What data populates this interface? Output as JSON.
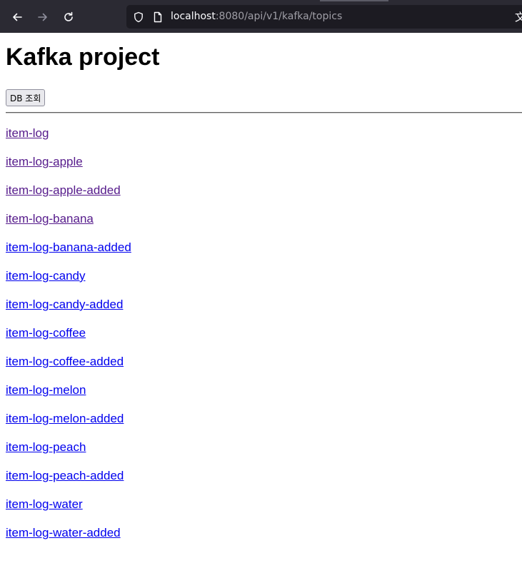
{
  "browser": {
    "url_host": "localhost",
    "url_rest": ":8080/api/v1/kafka/topics",
    "translate_glyph": "文"
  },
  "page": {
    "title": "Kafka project",
    "db_button_label": "DB 조회"
  },
  "topics": [
    {
      "label": "item-log",
      "visited": true
    },
    {
      "label": "item-log-apple",
      "visited": true
    },
    {
      "label": "item-log-apple-added",
      "visited": true
    },
    {
      "label": "item-log-banana",
      "visited": true
    },
    {
      "label": "item-log-banana-added",
      "visited": false
    },
    {
      "label": "item-log-candy",
      "visited": false
    },
    {
      "label": "item-log-candy-added",
      "visited": false
    },
    {
      "label": "item-log-coffee",
      "visited": false
    },
    {
      "label": "item-log-coffee-added",
      "visited": false
    },
    {
      "label": "item-log-melon",
      "visited": false
    },
    {
      "label": "item-log-melon-added",
      "visited": false
    },
    {
      "label": "item-log-peach",
      "visited": false
    },
    {
      "label": "item-log-peach-added",
      "visited": false
    },
    {
      "label": "item-log-water",
      "visited": false
    },
    {
      "label": "item-log-water-added",
      "visited": false
    }
  ],
  "colors": {
    "link": "#0000ee",
    "link_visited": "#551a8b",
    "toolbar": "#2b2a33",
    "urlbar": "#1c1b22"
  }
}
